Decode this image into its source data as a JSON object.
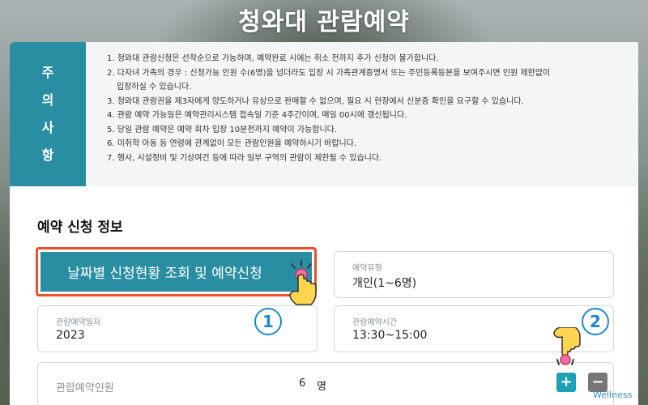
{
  "page": {
    "title": "청와대 관람예약"
  },
  "notice": {
    "side_chars": [
      "주",
      "의",
      "사",
      "항"
    ],
    "items": [
      "1. 청와대 관람신청은 선착순으로 가능하며, 예약완료 시에는 취소 전까지 추가 신청이 불가합니다.",
      "2. 다자녀 가족의 경우 : 신청가능 인원 수(6명)을 넘더라도 입장 시 가족관계증명서 또는 주민등록등본을 보여주시면 인원 제한없이",
      "   입장하실 수 있습니다.",
      "3. 청와대 관람권을 제3자에게 양도하거나 유상으로 판매할 수 없으며, 필요 시 현장에서 신분증 확인을 요구할 수 있습니다.",
      "4. 관람 예약 가능일은 예약관리시스템 접속일 기준 4주간이며, 매일 00시에 갱신됩니다.",
      "5. 당일 관람 예약은 예약 회차 입장 10분전까지 예약이 가능합니다.",
      "6. 미취학 아동 등 연령에 관계없이 모든 관람인원을 예약하시기 바랍니다.",
      "7. 행사, 시설정비 및 기상여건 등에 따라 일부 구역의 관람이 제한될 수 있습니다."
    ]
  },
  "reservation": {
    "section_title": "예약 신청 정보",
    "date_button_label": "날짜별 신청현황 조회 및 예약신청",
    "type_field": {
      "label": "예약유형",
      "value": "개인(1~6명)"
    },
    "date_field": {
      "label": "관람예약일자",
      "value": "2023"
    },
    "time_field": {
      "label": "관람예약시간",
      "value": "13:30~15:00"
    },
    "people_field": {
      "label": "관람예약인원",
      "count": "6",
      "unit": "명"
    },
    "plus_label": "+",
    "minus_label": "−"
  },
  "overlays": {
    "step1": "1",
    "step2": "2",
    "watermark": "Wellness"
  },
  "colors": {
    "accent_teal": "#2a8ea3",
    "highlight_orange": "#e8512a",
    "badge_blue": "#1e88c9",
    "plus_teal": "#1ea0b6",
    "minus_gray": "#777777"
  },
  "icons": {
    "pointer": "pointing-hand-icon",
    "plus": "plus-icon",
    "minus": "minus-icon"
  }
}
